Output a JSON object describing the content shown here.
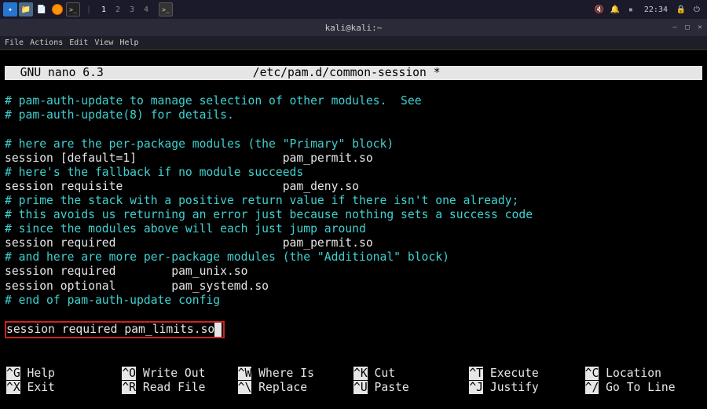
{
  "panel": {
    "workspaces": [
      "1",
      "2",
      "3",
      "4"
    ],
    "active_ws": 0,
    "clock": "22:34"
  },
  "window": {
    "title": "kali@kali:~"
  },
  "menubar": [
    "File",
    "Actions",
    "Edit",
    "View",
    "Help"
  ],
  "nano": {
    "title_left": "  GNU nano 6.3",
    "title_center": "/etc/pam.d/common-session *",
    "lines": [
      {
        "t": "# pam-auth-update to manage selection of other modules.  See",
        "c": "cyan"
      },
      {
        "t": "# pam-auth-update(8) for details.",
        "c": "cyan"
      },
      {
        "t": "",
        "c": "white"
      },
      {
        "t": "# here are the per-package modules (the \"Primary\" block)",
        "c": "cyan"
      },
      {
        "t": "session [default=1]                     pam_permit.so",
        "c": "white"
      },
      {
        "t": "# here's the fallback if no module succeeds",
        "c": "cyan"
      },
      {
        "t": "session requisite                       pam_deny.so",
        "c": "white"
      },
      {
        "t": "# prime the stack with a positive return value if there isn't one already;",
        "c": "cyan"
      },
      {
        "t": "# this avoids us returning an error just because nothing sets a success code",
        "c": "cyan"
      },
      {
        "t": "# since the modules above will each just jump around",
        "c": "cyan"
      },
      {
        "t": "session required                        pam_permit.so",
        "c": "white"
      },
      {
        "t": "# and here are more per-package modules (the \"Additional\" block)",
        "c": "cyan"
      },
      {
        "t": "session required        pam_unix.so",
        "c": "white"
      },
      {
        "t": "session optional        pam_systemd.so",
        "c": "white"
      },
      {
        "t": "# end of pam-auth-update config",
        "c": "cyan"
      }
    ],
    "highlighted_line": "session required pam_limits.so",
    "shortcuts": [
      {
        "k": "^G",
        "l": " Help"
      },
      {
        "k": "^O",
        "l": " Write Out"
      },
      {
        "k": "^W",
        "l": " Where Is"
      },
      {
        "k": "^K",
        "l": " Cut"
      },
      {
        "k": "^T",
        "l": " Execute"
      },
      {
        "k": "^C",
        "l": " Location"
      },
      {
        "k": "^X",
        "l": " Exit"
      },
      {
        "k": "^R",
        "l": " Read File"
      },
      {
        "k": "^\\",
        "l": " Replace"
      },
      {
        "k": "^U",
        "l": " Paste"
      },
      {
        "k": "^J",
        "l": " Justify"
      },
      {
        "k": "^/",
        "l": " Go To Line"
      }
    ]
  }
}
